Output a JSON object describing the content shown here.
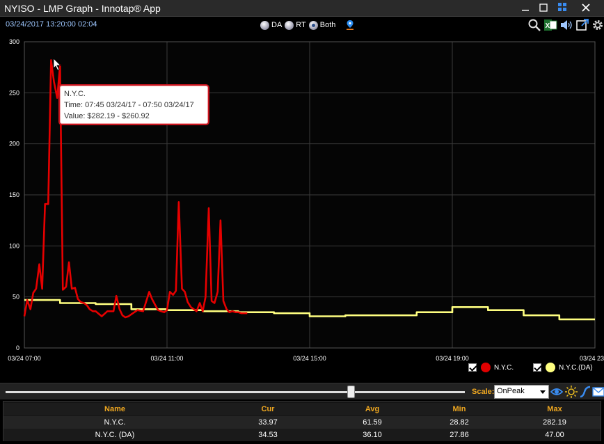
{
  "window": {
    "title": "NYISO - LMP Graph - Innotap® App"
  },
  "toolbar": {
    "timestamp": "03/24/2017 13:20:00  02:04",
    "radio_options": [
      {
        "label": "DA",
        "selected": false
      },
      {
        "label": "RT",
        "selected": false
      },
      {
        "label": "Both",
        "selected": true
      }
    ]
  },
  "tooltip": {
    "line1": "N.Y.C.",
    "line2": "Time: 07:45 03/24/17 - 07:50 03/24/17",
    "line3": "Value: $282.19 - $260.92"
  },
  "legend": [
    {
      "label": "N.Y.C.",
      "color": "#e00000",
      "checked": true
    },
    {
      "label": "N.Y.C.(DA)",
      "color": "#ffff80",
      "checked": true
    }
  ],
  "bottombar": {
    "scale_label": "Scale:",
    "scale_value": "OnPeak"
  },
  "stats_table": {
    "headers": [
      "Name",
      "Cur",
      "Avg",
      "Min",
      "Max"
    ],
    "rows": [
      [
        "N.Y.C.",
        "33.97",
        "61.59",
        "28.82",
        "282.19"
      ],
      [
        "N.Y.C. (DA)",
        "34.53",
        "36.10",
        "27.86",
        "47.00"
      ]
    ]
  },
  "chart_data": {
    "type": "line",
    "ylim": [
      0,
      300
    ],
    "y_ticks": [
      "0",
      "50",
      "100",
      "150",
      "200",
      "250",
      "300"
    ],
    "x_tick_labels": [
      "03/24 07:00",
      "03/24 11:00",
      "03/24 15:00",
      "03/24 19:00",
      "03/24 23"
    ],
    "xlim_hours": [
      7,
      23
    ],
    "series": [
      {
        "name": "N.Y.C.",
        "color": "#e60000",
        "x": [
          7.0,
          7.08,
          7.17,
          7.25,
          7.33,
          7.42,
          7.5,
          7.58,
          7.67,
          7.75,
          7.83,
          7.92,
          8.0,
          8.08,
          8.17,
          8.25,
          8.33,
          8.42,
          8.5,
          8.58,
          8.67,
          8.75,
          8.83,
          8.92,
          9.0,
          9.17,
          9.33,
          9.5,
          9.58,
          9.67,
          9.75,
          9.83,
          9.92,
          10.0,
          10.17,
          10.33,
          10.5,
          10.58,
          10.67,
          10.75,
          10.83,
          10.92,
          11.0,
          11.08,
          11.17,
          11.25,
          11.33,
          11.42,
          11.5,
          11.58,
          11.67,
          11.75,
          11.83,
          11.92,
          12.0,
          12.08,
          12.17,
          12.25,
          12.33,
          12.42,
          12.5,
          12.58,
          12.67,
          12.75,
          12.83,
          12.92,
          13.0,
          13.08,
          13.17,
          13.25
        ],
        "y": [
          31,
          47,
          38,
          54,
          58,
          82,
          58,
          141,
          141,
          282,
          261,
          245,
          277,
          57,
          60,
          84,
          58,
          59,
          48,
          45,
          44,
          42,
          38,
          36,
          36,
          31,
          36,
          36,
          51,
          38,
          32,
          30,
          31,
          33,
          37,
          36,
          55,
          48,
          42,
          37,
          36,
          35,
          37,
          55,
          52,
          56,
          143,
          58,
          55,
          45,
          40,
          38,
          36,
          44,
          36,
          50,
          137,
          46,
          44,
          55,
          125,
          46,
          38,
          35,
          36,
          35,
          35,
          34,
          34,
          34
        ]
      },
      {
        "name": "N.Y.C.(DA)",
        "color": "#ffff80",
        "x": [
          7,
          8,
          8,
          9,
          9,
          10,
          10,
          11,
          11,
          12,
          12,
          13,
          13,
          14,
          14,
          15,
          15,
          16,
          16,
          17,
          17,
          18,
          18,
          19,
          19,
          20,
          20,
          21,
          21,
          22,
          22,
          23
        ],
        "y": [
          47,
          47,
          44,
          44,
          43,
          43,
          38,
          38,
          37,
          37,
          36,
          36,
          35,
          35,
          34,
          34,
          31,
          31,
          32,
          32,
          32,
          32,
          35,
          35,
          40,
          40,
          37,
          37,
          32,
          32,
          28,
          28
        ]
      }
    ]
  }
}
